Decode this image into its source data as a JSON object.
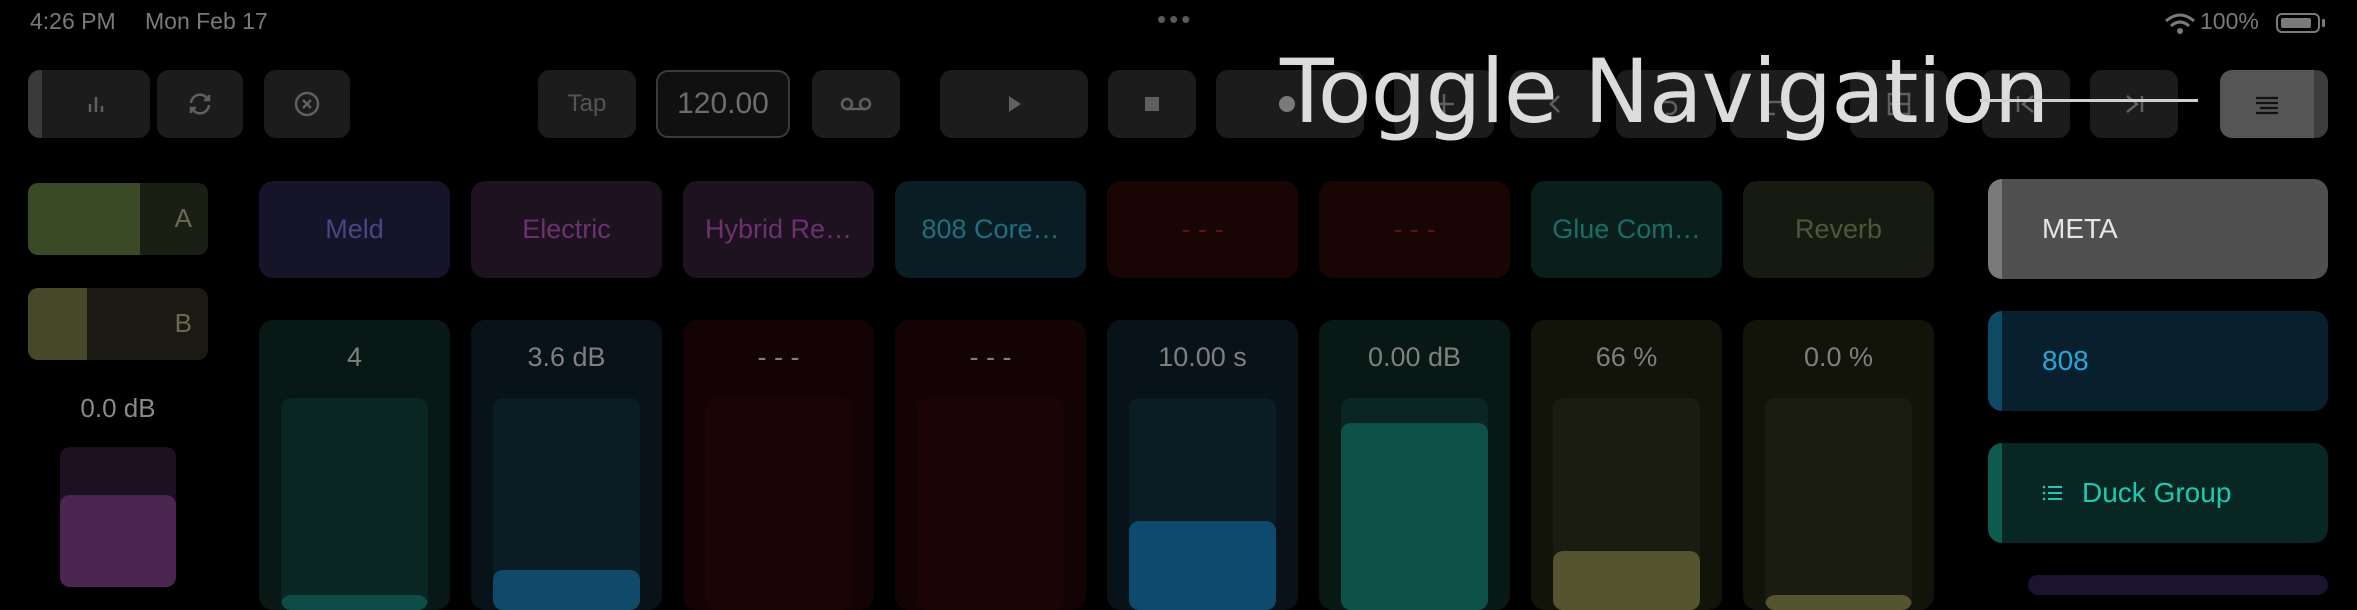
{
  "status_bar": {
    "time": "4:26 PM",
    "date": "Mon Feb 17",
    "battery": "100%"
  },
  "toolbar": {
    "tap_label": "Tap",
    "tempo_value": "120.00",
    "icons": [
      "bars-icon",
      "loop-icon",
      "close-circle-icon",
      "tape-icon",
      "play-icon",
      "stop-icon",
      "record-icon",
      "add-icon",
      "back-icon",
      "undo-icon",
      "redo-icon",
      "grid-icon",
      "skip-back-icon",
      "skip-forward-icon",
      "menu-icon"
    ]
  },
  "overlay": {
    "title": "Toggle Navigation"
  },
  "crossfader": {
    "a_label": "A",
    "a_level": 0.62,
    "b_label": "B",
    "b_level": 0.33,
    "volume_label": "0.0 dB",
    "volume_level": 0.66
  },
  "devices": [
    {
      "label": "Meld",
      "bg": "#151428",
      "fg": "#4a4585"
    },
    {
      "label": "Electric",
      "bg": "#1f1220",
      "fg": "#6a3370"
    },
    {
      "label": "Hybrid Re…",
      "bg": "#1f1220",
      "fg": "#6a3370"
    },
    {
      "label": "808 Core…",
      "bg": "#0a1d24",
      "fg": "#1f6f80"
    },
    {
      "label": "- - -",
      "bg": "#1a0505",
      "fg": "#5a1515"
    },
    {
      "label": "- - -",
      "bg": "#1a0505",
      "fg": "#5a1515"
    },
    {
      "label": "Glue Com…",
      "bg": "#0a1e1c",
      "fg": "#1a6e64"
    },
    {
      "label": "Reverb",
      "bg": "#171a10",
      "fg": "#50563a"
    }
  ],
  "macros": [
    {
      "value": "4",
      "level": 0.07,
      "bg": "#081815",
      "track": "#0a2622",
      "fill": "#0c4d45"
    },
    {
      "value": "3.6 dB",
      "level": 0.19,
      "bg": "#081319",
      "track": "#0a1c24",
      "fill": "#104a6a"
    },
    {
      "value": "- - -",
      "level": 0,
      "bg": "#140305",
      "track": "#1a0406",
      "fill": "#1a0406"
    },
    {
      "value": "- - -",
      "level": 0,
      "bg": "#140305",
      "track": "#1a0406",
      "fill": "#1a0406"
    },
    {
      "value": "10.00 s",
      "level": 0.42,
      "bg": "#081319",
      "track": "#0a1c24",
      "fill": "#0e4a6e"
    },
    {
      "value": "0.00 dB",
      "level": 0.88,
      "bg": "#081815",
      "track": "#0a2622",
      "fill": "#0d5248"
    },
    {
      "value": "66 %",
      "level": 0.28,
      "bg": "#121309",
      "track": "#1a1b11",
      "fill": "#54542e"
    },
    {
      "value": "0.0 %",
      "level": 0.07,
      "bg": "#121309",
      "track": "#1a1b11",
      "fill": "#54542e"
    }
  ],
  "right_panel": [
    {
      "label": "META",
      "bg": "#505050",
      "fg": "#e5e5e5",
      "accent": "#7a7a7a"
    },
    {
      "label": "808",
      "bg": "#08202e",
      "fg": "#2aa6d6",
      "accent": "#0e4a66"
    },
    {
      "label": "Duck Group",
      "bg": "#082622",
      "fg": "#1ec9b3",
      "accent": "#0c5a50",
      "icon": "list-icon"
    }
  ]
}
